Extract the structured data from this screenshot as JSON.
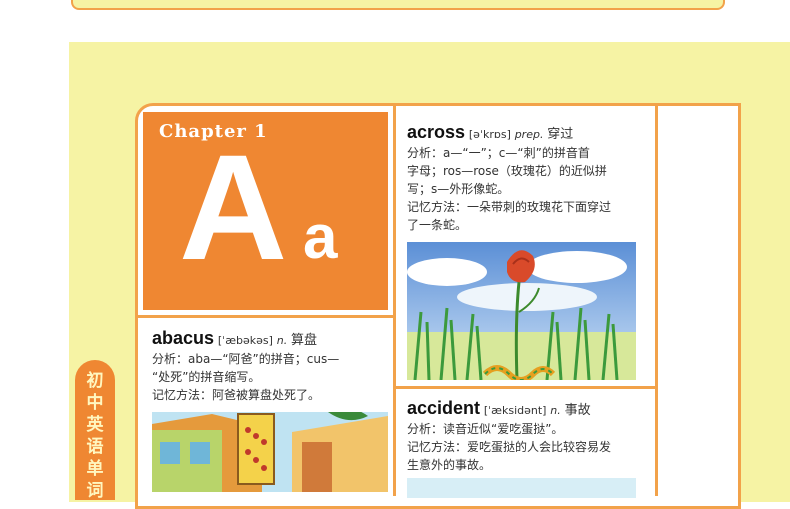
{
  "chapter": {
    "label": "Chapter 1",
    "big_letter": "A",
    "small_letter": "a"
  },
  "side_tab": {
    "chars": [
      "初",
      "中",
      "英",
      "语",
      "单",
      "词"
    ]
  },
  "entries": {
    "abacus": {
      "word": "abacus",
      "phonetic": "[ˈæbəkəs]",
      "pos": "n.",
      "meaning": "算盘",
      "analysis_1": "分析：aba—“阿爸”的拼音；cus—",
      "analysis_2": "“处死”的拼音缩写。",
      "memory": "记忆方法：阿爸被算盘处死了。"
    },
    "across": {
      "word": "across",
      "phonetic": "[əˈkrɒs]",
      "pos": "prep.",
      "meaning": "穿过",
      "analysis_1": "分析：a—“一”；c—“刺”的拼音首",
      "analysis_2": "字母；ros—rose（玫瑰花）的近似拼",
      "analysis_3": "写；s—外形像蛇。",
      "memory_1": "记忆方法：一朵带刺的玫瑰花下面穿过",
      "memory_2": "了一条蛇。"
    },
    "accident": {
      "word": "accident",
      "phonetic": "[ˈæksidənt]",
      "pos": "n.",
      "meaning": "事故",
      "analysis": "分析：读音近似“爱吃蛋挞”。",
      "memory_1": "记忆方法：爱吃蛋挞的人会比较容易发",
      "memory_2": "生意外的事故。"
    }
  },
  "colors": {
    "orange": "#ef8732",
    "page": "#f6f3a4",
    "border": "#f2a24a"
  }
}
